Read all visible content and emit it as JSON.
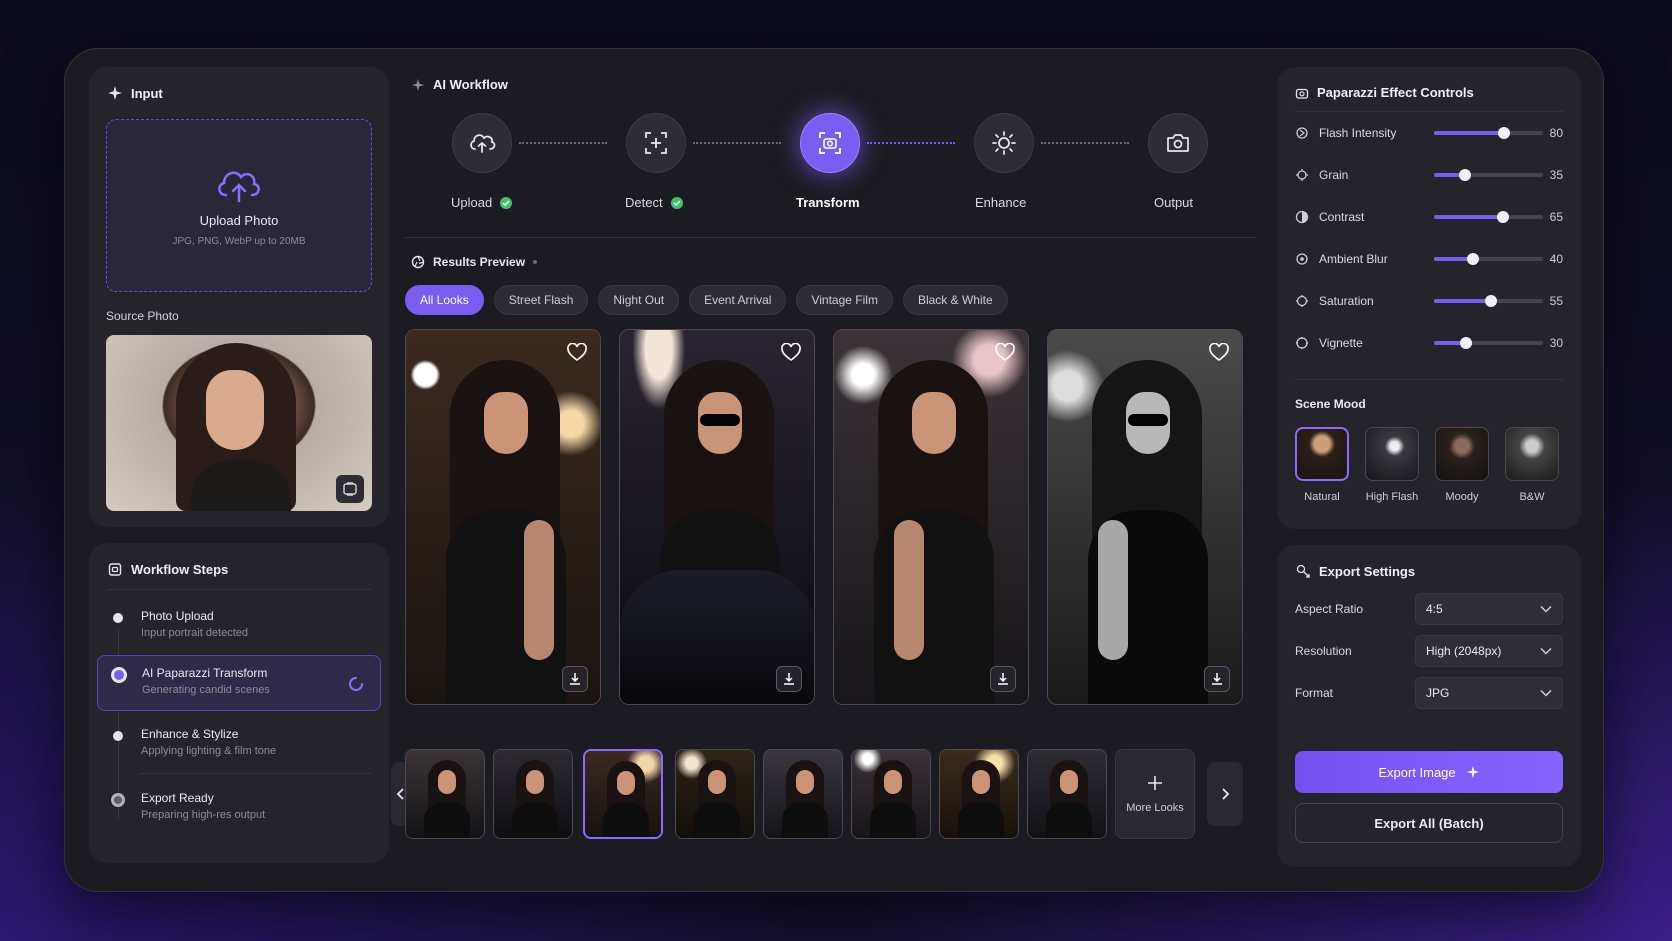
{
  "input": {
    "title": "Input",
    "upload_title": "Upload Photo",
    "upload_hint": "JPG, PNG, WebP up to 20MB",
    "source_label": "Source Photo"
  },
  "workflow_steps": {
    "title": "Workflow Steps",
    "items": [
      {
        "title": "Photo Upload",
        "subtitle": "Input portrait detected"
      },
      {
        "title": "AI Paparazzi Transform",
        "subtitle": "Generating candid scenes"
      },
      {
        "title": "Enhance & Stylize",
        "subtitle": "Applying lighting & film tone"
      },
      {
        "title": "Export Ready",
        "subtitle": "Preparing high-res output"
      }
    ]
  },
  "ai_workflow": {
    "title": "AI Workflow",
    "nodes": [
      {
        "label": "Upload",
        "done": true,
        "icon": "cloud-upload-icon"
      },
      {
        "label": "Detect",
        "done": true,
        "icon": "face-scan-icon"
      },
      {
        "label": "Transform",
        "done": false,
        "icon": "focus-camera-icon"
      },
      {
        "label": "Enhance",
        "done": false,
        "icon": "sun-icon"
      },
      {
        "label": "Output",
        "done": false,
        "icon": "camera-icon"
      }
    ]
  },
  "results": {
    "title": "Results Preview",
    "filters": [
      "All Looks",
      "Street Flash",
      "Night Out",
      "Event Arrival",
      "Vintage Film",
      "Black & White"
    ],
    "active_filter": "All Looks",
    "more_label": "More Looks"
  },
  "effects": {
    "title": "Paparazzi Effect Controls",
    "controls": [
      {
        "label": "Flash Intensity",
        "value": "80"
      },
      {
        "label": "Grain",
        "value": "35"
      },
      {
        "label": "Contrast",
        "value": "65"
      },
      {
        "label": "Ambient Blur",
        "value": "40"
      },
      {
        "label": "Saturation",
        "value": "55"
      },
      {
        "label": "Vignette",
        "value": "30"
      }
    ],
    "mood_title": "Scene Mood",
    "moods": [
      "Natural",
      "High Flash",
      "Moody",
      "B&W"
    ],
    "active_mood": "Natural"
  },
  "export": {
    "title": "Export Settings",
    "rows": [
      {
        "label": "Aspect Ratio",
        "value": "4:5"
      },
      {
        "label": "Resolution",
        "value": "High (2048px)"
      },
      {
        "label": "Format",
        "value": "JPG"
      }
    ],
    "primary_label": "Export Image",
    "secondary_label": "Export All (Batch)"
  },
  "colors": {
    "accent": "#7b5cf0",
    "success": "#3fc46a",
    "panel": "#25242b"
  }
}
